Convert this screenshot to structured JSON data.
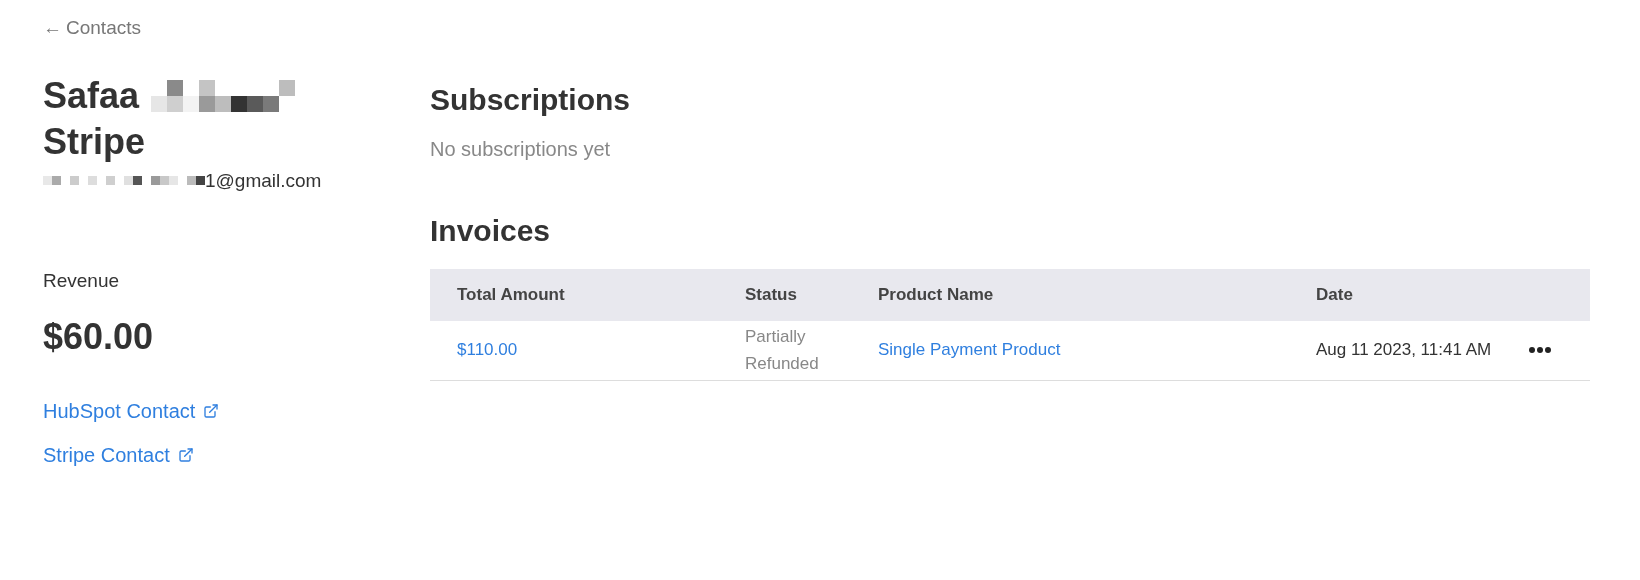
{
  "back_link": {
    "arrow": "←",
    "label": "Contacts"
  },
  "contact": {
    "first_name": "Safaa",
    "last_name": "Stripe",
    "email": "1@gmail.com"
  },
  "revenue": {
    "label": "Revenue",
    "amount": "$60.00"
  },
  "links": [
    {
      "label": "HubSpot Contact"
    },
    {
      "label": "Stripe Contact"
    }
  ],
  "subscriptions": {
    "title": "Subscriptions",
    "empty_text": "No subscriptions yet"
  },
  "invoices": {
    "title": "Invoices",
    "columns": [
      "Total Amount",
      "Status",
      "Product Name",
      "Date"
    ],
    "rows": [
      {
        "total": "$110.00",
        "status": "Partially Refunded",
        "product": "Single Payment Product",
        "date": "Aug 11 2023, 11:41 AM"
      }
    ]
  }
}
